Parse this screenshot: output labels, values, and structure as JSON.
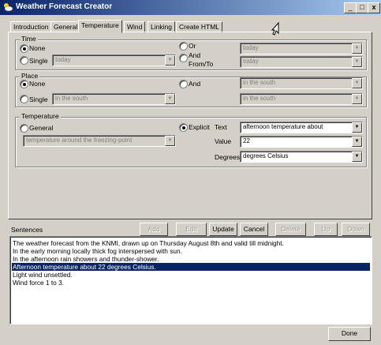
{
  "window": {
    "title": "Weather Forecast Creator",
    "minimize": "_",
    "maximize": "□",
    "close": "x"
  },
  "tabs": [
    "Introduction",
    "General",
    "Temperature",
    "Wind",
    "Linking",
    "Create HTML"
  ],
  "time": {
    "legend": "Time",
    "none": "None",
    "single": "Single",
    "or": "Or",
    "and": "And",
    "from_to": "From/To",
    "single_value": "today",
    "right1_value": "today",
    "right2_value": "today",
    "selected": "None"
  },
  "place": {
    "legend": "Place",
    "none": "None",
    "single": "Single",
    "and": "And",
    "right1_value": "in the south",
    "single_value": "in the south",
    "right2_value": "in the south",
    "selected": "None"
  },
  "temperature": {
    "legend": "Temperature",
    "general": "General",
    "explicit": "Explicit",
    "general_value": "temperature around the freezing-point",
    "text_label": "Text",
    "text_value": "afternoon temperature about",
    "value_label": "Value",
    "value_value": "22",
    "degrees_label": "Degrees",
    "degrees_value": "degrees Celsius",
    "selected": "Explicit"
  },
  "sentences": {
    "label": "Sentences",
    "buttons": {
      "add": "Add",
      "edit": "Edit",
      "update": "Update",
      "cancel": "Cancel",
      "delete": "Delete",
      "up": "Up",
      "down": "Down"
    },
    "lines": [
      "The weather forecast from the KNMI, drawn up on Thursday August 8th and valid till midnight.",
      "In the early morning locally thick fog interspersed with sun.",
      "In the afternoon rain showers and thunder-shower.",
      "Afternoon temperature about 22 degrees Celsius.",
      "Light wind unsettled.",
      "Wind force 1 to 3."
    ],
    "selected_index": 3
  },
  "done": "Done",
  "colors": {
    "titlebar_start": "#0a246a",
    "titlebar_end": "#a6caf0",
    "selection": "#0a246a",
    "face": "#d4d0c8"
  }
}
